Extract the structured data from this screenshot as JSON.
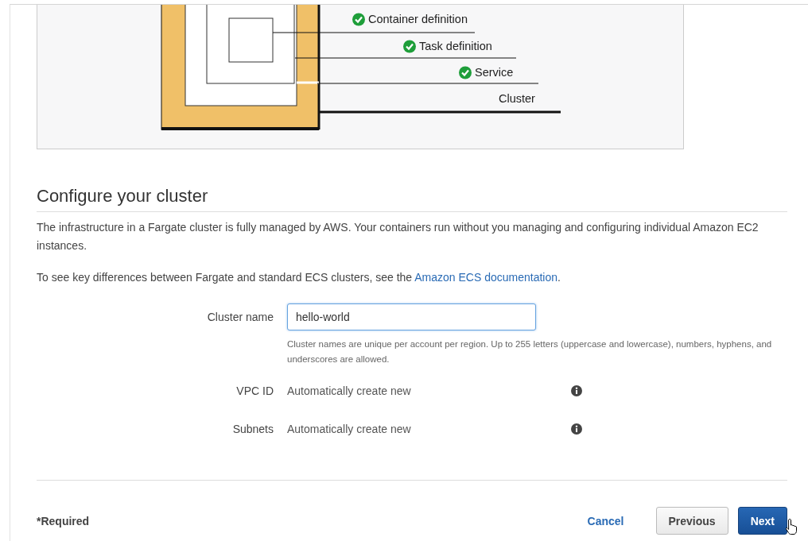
{
  "diagram": {
    "labels": [
      {
        "text": "Container definition",
        "checked": true
      },
      {
        "text": "Task definition",
        "checked": true
      },
      {
        "text": "Service",
        "checked": true
      },
      {
        "text": "Cluster",
        "checked": false
      }
    ]
  },
  "section": {
    "title": "Configure your cluster",
    "intro": "The infrastructure in a Fargate cluster is fully managed by AWS. Your containers run without you managing and configuring individual Amazon EC2 instances.",
    "note": {
      "before": "To see key differences between Fargate and standard ECS clusters, see the ",
      "link": "Amazon ECS documentation",
      "after": "."
    }
  },
  "form": {
    "fields": [
      {
        "kind": "input",
        "label": "Cluster name",
        "value": "hello-world",
        "hint": "Cluster names are unique per account per region. Up to 255 letters (uppercase and lowercase), numbers, hyphens, and underscores are allowed."
      },
      {
        "kind": "static",
        "label": "VPC ID",
        "value": "Automatically create new"
      },
      {
        "kind": "static",
        "label": "Subnets",
        "value": "Automatically create new"
      }
    ]
  },
  "footer": {
    "required": "*Required",
    "buttons": [
      {
        "kind": "link",
        "label": "Cancel"
      },
      {
        "kind": "secondary",
        "label": "Previous"
      },
      {
        "kind": "primary",
        "label": "Next"
      }
    ]
  }
}
